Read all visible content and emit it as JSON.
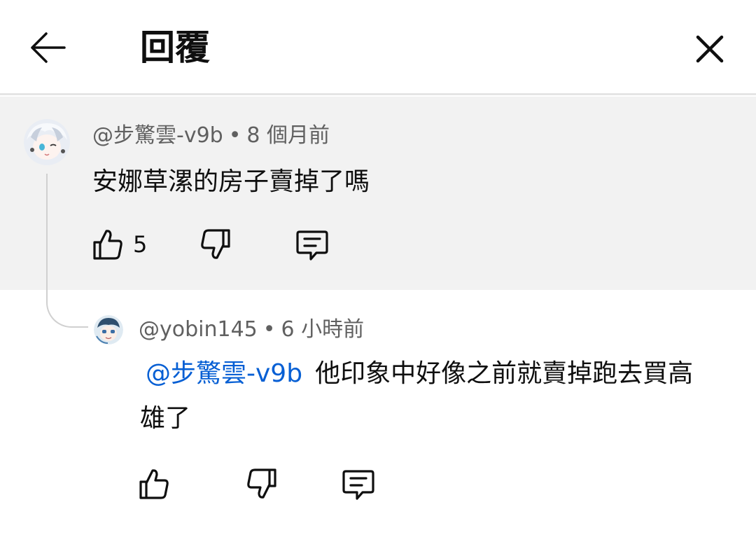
{
  "header": {
    "title": "回覆",
    "back_icon": "arrow-left-icon",
    "close_icon": "close-icon"
  },
  "parent_comment": {
    "author": "@步驚雲-v9b",
    "separator": "•",
    "time": "8 個月前",
    "text": "安娜草漯的房子賣掉了嗎",
    "like_count": "5"
  },
  "reply": {
    "author": "@yobin145",
    "separator": "•",
    "time": "6 小時前",
    "mention": "@步驚雲-v9b",
    "text": "他印象中好像之前就賣掉跑去買高雄了"
  },
  "colors": {
    "mention": "#065fd4",
    "parent_bg": "#f2f2f2",
    "meta": "#606060"
  }
}
